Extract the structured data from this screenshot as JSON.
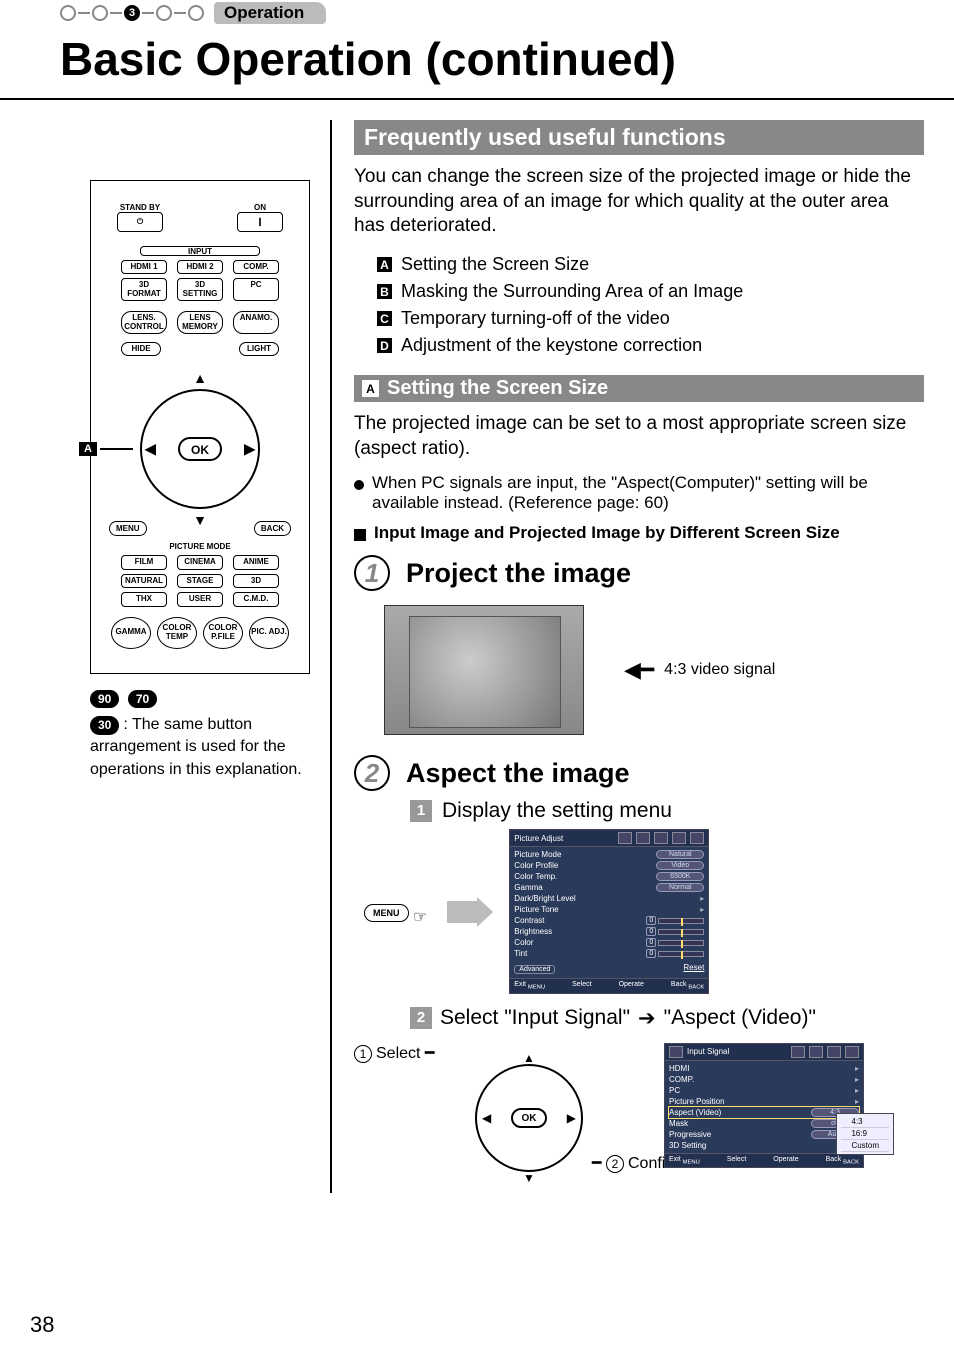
{
  "header": {
    "step_active": "3",
    "tab": "Operation"
  },
  "title": "Basic Operation (continued)",
  "remote": {
    "top": {
      "standby": "STAND BY",
      "on": "ON"
    },
    "input_label": "INPUT",
    "inputs_row1": [
      "HDMI 1",
      "HDMI 2",
      "COMP."
    ],
    "inputs_row2": [
      "3D FORMAT",
      "3D SETTING",
      "PC"
    ],
    "lens_row": [
      "LENS. CONTROL",
      "LENS MEMORY",
      "ANAMO."
    ],
    "hide": "HIDE",
    "light": "LIGHT",
    "ok": "OK",
    "menu": "MENU",
    "back": "BACK",
    "pm_label": "PICTURE MODE",
    "pm_row1": [
      "FILM",
      "CINEMA",
      "ANIME"
    ],
    "pm_row2": [
      "NATURAL",
      "STAGE",
      "3D"
    ],
    "pm_row3": [
      "THX",
      "USER",
      "C.M.D."
    ],
    "round_row": [
      "GAMMA",
      "COLOR TEMP",
      "COLOR P.FILE",
      "PIC. ADJ."
    ],
    "callout": "A"
  },
  "remote_caption": {
    "refs": [
      "90",
      "70"
    ],
    "ref_small": "30",
    "text": ": The same button arrangement is used for the operations in this explanation."
  },
  "right": {
    "section1_title": "Frequently used useful functions",
    "section1_intro": "You can change the screen size of the projected image or hide the surrounding area of an image for which quality at the outer area has deteriorated.",
    "index": [
      {
        "badge": "A",
        "text": "Setting the Screen Size"
      },
      {
        "badge": "B",
        "text": "Masking the Surrounding Area of an Image"
      },
      {
        "badge": "C",
        "text": "Temporary turning-off of the video"
      },
      {
        "badge": "D",
        "text": "Adjustment of the keystone correction"
      }
    ],
    "sectionA_badge": "A",
    "sectionA_title": "Setting the Screen Size",
    "sectionA_intro": "The projected image can be set to a most appropriate screen size (aspect ratio).",
    "sectionA_note": "When PC signals are input, the \"Aspect(Computer)\" setting will be available instead. (Reference page: 60)",
    "sectionA_sub": "Input Image and Projected Image by Different Screen Size",
    "steps": {
      "s1": {
        "num": "1",
        "title": "Project the image",
        "signal_label": "4:3 video signal"
      },
      "s2": {
        "num": "2",
        "title": "Aspect the image",
        "sub1_num": "1",
        "sub1_text": "Display the setting menu",
        "menu_btn": "MENU",
        "sub2_num": "2",
        "sub2_text_a": "Select \"Input Signal\"",
        "sub2_text_b": "\"Aspect (Video)\"",
        "sel_label": "Select",
        "conf_label": "Confirm",
        "ok": "OK",
        "circ1": "1",
        "circ2": "2"
      }
    },
    "osd1": {
      "tab": "Picture Adjust",
      "rows": [
        {
          "k": "Picture Mode",
          "v": "Natural"
        },
        {
          "k": "Color Profile",
          "v": "Video"
        },
        {
          "k": "Color Temp.",
          "v": "6500K"
        },
        {
          "k": "Gamma",
          "v": "Normal"
        },
        {
          "k": "Dark/Bright Level",
          "v": ""
        },
        {
          "k": "Picture Tone",
          "v": ""
        },
        {
          "k": "Contrast",
          "slider": "0"
        },
        {
          "k": "Brightness",
          "slider": "0"
        },
        {
          "k": "Color",
          "slider": "0"
        },
        {
          "k": "Tint",
          "slider": "0"
        }
      ],
      "advanced": "Advanced",
      "reset": "Reset",
      "foot": {
        "exit": "Exit",
        "menu": "MENU",
        "select": "Select",
        "operate": "Operate",
        "back": "Back",
        "backbtn": "BACK"
      }
    },
    "osd2": {
      "tab": "Input Signal",
      "rows": [
        {
          "k": "HDMI",
          "v": ""
        },
        {
          "k": "COMP.",
          "v": ""
        },
        {
          "k": "PC",
          "v": ""
        },
        {
          "k": "Picture Position",
          "v": ""
        },
        {
          "k": "Aspect (Video)",
          "v": "4:3",
          "selected": true
        },
        {
          "k": "Mask",
          "v": "off"
        },
        {
          "k": "Progressive",
          "v": "Auto"
        },
        {
          "k": "3D Setting",
          "v": ""
        }
      ],
      "popup": [
        "4:3",
        "16:9",
        "Custom"
      ],
      "foot": {
        "exit": "Exit",
        "menu": "MENU",
        "select": "Select",
        "operate": "Operate",
        "back": "Back",
        "backbtn": "BACK"
      }
    }
  },
  "page_number": "38"
}
